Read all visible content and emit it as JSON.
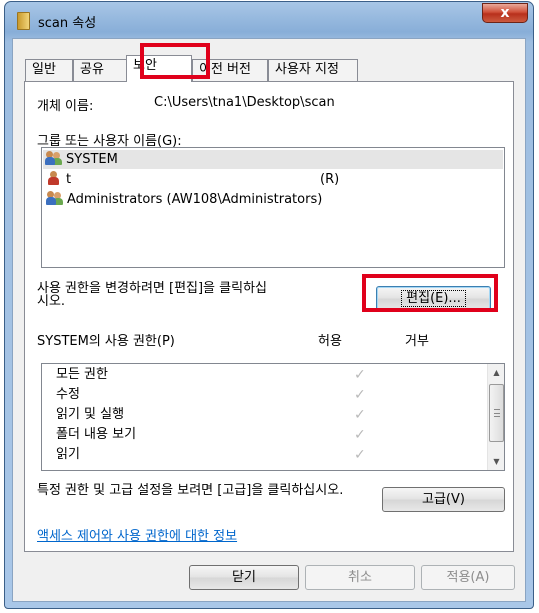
{
  "window": {
    "title": "scan 속성",
    "close_label": "x"
  },
  "tabs": [
    {
      "label": "일반"
    },
    {
      "label": "공유"
    },
    {
      "label": "보안"
    },
    {
      "label": "이전 버전"
    },
    {
      "label": "사용자 지정"
    }
  ],
  "security": {
    "object_name_label": "개체 이름:",
    "object_name_value": "C:\\Users\\tna1\\Desktop\\scan",
    "group_list_label": "그룹 또는 사용자 이름(G):",
    "users": [
      {
        "name": "SYSTEM",
        "icon": "users-group-icon",
        "selected": true
      },
      {
        "name": "t",
        "suffix": "(R)",
        "icon": "user-icon",
        "selected": false
      },
      {
        "name": "Administrators (AW108\\Administrators)",
        "icon": "users-group-icon",
        "selected": false
      }
    ],
    "change_hint": "사용 권한을 변경하려면 [편집]을 클릭하십시오.",
    "edit_button": "편집(E)...",
    "permissions_label": "SYSTEM의 사용 권한(P)",
    "allow_header": "허용",
    "deny_header": "거부",
    "permissions": [
      {
        "name": "모든 권한",
        "allow": true,
        "deny": false
      },
      {
        "name": "수정",
        "allow": true,
        "deny": false
      },
      {
        "name": "읽기 및 실행",
        "allow": true,
        "deny": false
      },
      {
        "name": "폴더 내용 보기",
        "allow": true,
        "deny": false
      },
      {
        "name": "읽기",
        "allow": true,
        "deny": false
      }
    ],
    "check_glyph": "✓",
    "advanced_hint": "특정 권한 및 고급 설정을 보려면 [고급]을 클릭하십시오.",
    "advanced_button": "고급(V)",
    "info_link": "액세스 제어와 사용 권한에 대한 정보"
  },
  "footer": {
    "close_button": "닫기",
    "cancel_button": "취소",
    "apply_button": "적용(A)"
  },
  "colors": {
    "highlight": "#e0001b",
    "link": "#0066cc"
  }
}
